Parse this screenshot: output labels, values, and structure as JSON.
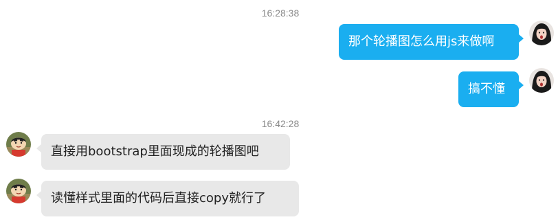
{
  "chat": {
    "timestamps": [
      "16:28:38",
      "16:42:28"
    ],
    "messages": [
      {
        "direction": "outgoing",
        "text": "那个轮播图怎么用js来做啊",
        "avatar": "self-avatar"
      },
      {
        "direction": "outgoing",
        "text": "搞不懂",
        "avatar": "self-avatar"
      },
      {
        "direction": "incoming",
        "text": "直接用bootstrap里面现成的轮播图吧",
        "avatar": "contact-avatar"
      },
      {
        "direction": "incoming",
        "text": "读懂样式里面的代码后直接copy就行了",
        "avatar": "contact-avatar"
      }
    ]
  },
  "colors": {
    "outgoing_bubble": "#1aaef0",
    "incoming_bubble": "#e8e8e8",
    "timestamp_text": "#8a8a8a"
  }
}
